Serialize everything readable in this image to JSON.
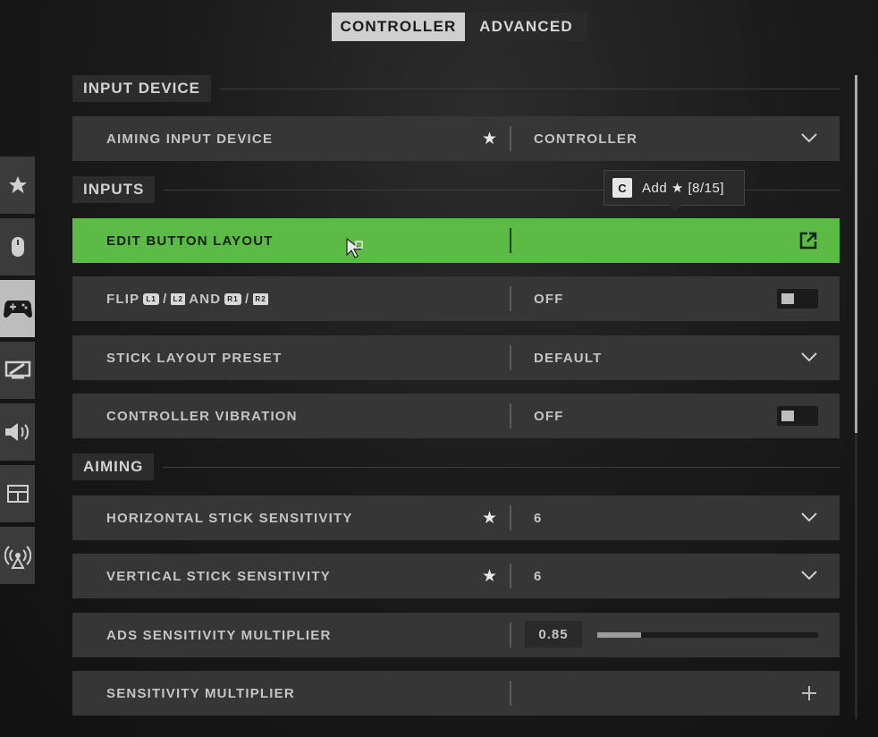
{
  "tabs": [
    {
      "label": "CONTROLLER",
      "active": true
    },
    {
      "label": "ADVANCED",
      "active": false
    }
  ],
  "sidebar": [
    {
      "icon": "star-icon"
    },
    {
      "icon": "mouse-icon"
    },
    {
      "icon": "gamepad-icon",
      "active": true
    },
    {
      "icon": "display-icon"
    },
    {
      "icon": "speaker-icon"
    },
    {
      "icon": "interface-icon"
    },
    {
      "icon": "network-icon"
    }
  ],
  "sections": {
    "input_device": "INPUT DEVICE",
    "inputs": "INPUTS",
    "aiming": "AIMING"
  },
  "rows": {
    "aiming_input_device": {
      "label": "AIMING INPUT DEVICE",
      "value": "CONTROLLER"
    },
    "edit_button_layout": {
      "label": "EDIT BUTTON LAYOUT"
    },
    "flip": {
      "label_prefix": "FLIP",
      "sep1": "/",
      "and": "AND",
      "sep2": "/",
      "b1": "L1",
      "b2": "L2",
      "b3": "R1",
      "b4": "R2",
      "value": "OFF"
    },
    "stick_layout_preset": {
      "label": "STICK LAYOUT PRESET",
      "value": "DEFAULT"
    },
    "controller_vibration": {
      "label": "CONTROLLER VIBRATION",
      "value": "OFF"
    },
    "horizontal_stick_sensitivity": {
      "label": "HORIZONTAL STICK SENSITIVITY",
      "value": "6"
    },
    "vertical_stick_sensitivity": {
      "label": "VERTICAL STICK SENSITIVITY",
      "value": "6"
    },
    "ads_sensitivity_multiplier": {
      "label": "ADS SENSITIVITY MULTIPLIER",
      "value": "0.85",
      "slider_fraction": 0.2
    },
    "sensitivity_multiplier": {
      "label": "SENSITIVITY MULTIPLIER"
    }
  },
  "star_glyph": "★",
  "tooltip": {
    "key": "C",
    "text": "Add ★ [8/15]"
  },
  "colors": {
    "highlight": "#5cba47",
    "row_bg": "#363636"
  }
}
